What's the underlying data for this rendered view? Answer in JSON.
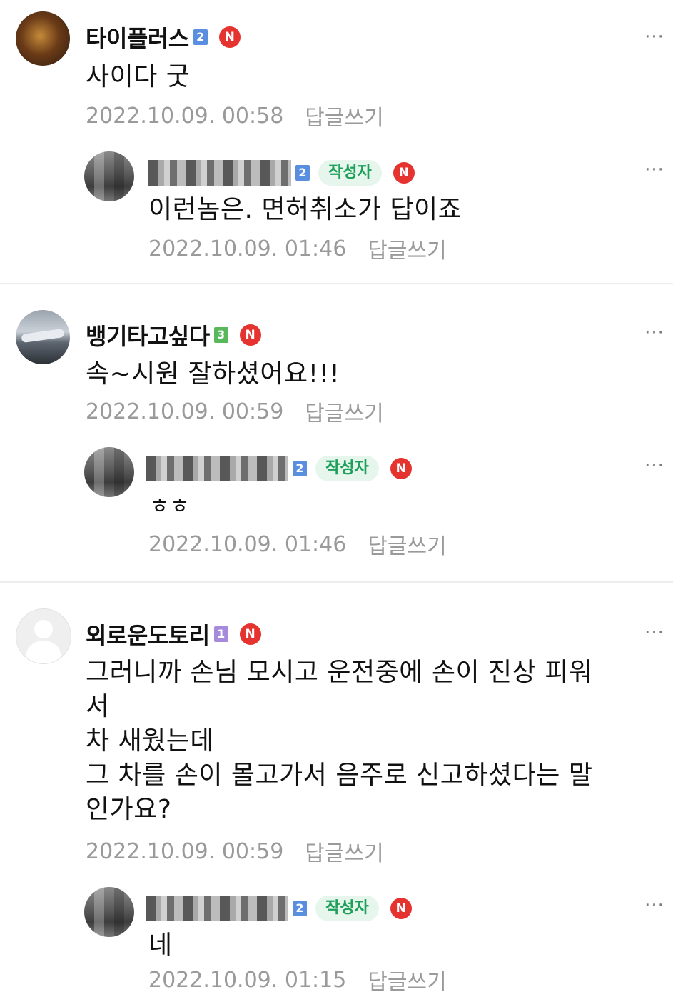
{
  "comments": [
    {
      "nickname": "타이플러스",
      "level": "2",
      "new": "N",
      "text": "사이다 굿",
      "date": "2022.10.09. 00:58",
      "reply_label": "답글쓰기",
      "more": "···",
      "reply": {
        "level": "2",
        "author_badge": "작성자",
        "new": "N",
        "text": "이런놈은. 면허취소가 답이죠",
        "date": "2022.10.09. 01:46",
        "reply_label": "답글쓰기",
        "more": "···"
      }
    },
    {
      "nickname": "뱅기타고싶다",
      "level": "3",
      "new": "N",
      "text": "속~시원 잘하셨어요!!!",
      "date": "2022.10.09. 00:59",
      "reply_label": "답글쓰기",
      "more": "···",
      "reply": {
        "level": "2",
        "author_badge": "작성자",
        "new": "N",
        "text": "ㅎㅎ",
        "date": "2022.10.09. 01:46",
        "reply_label": "답글쓰기",
        "more": "···"
      }
    },
    {
      "nickname": "외로운도토리",
      "level": "1",
      "new": "N",
      "text": "그러니까 손님 모시고 운전중에 손이 진상 피워\n서\n차 새웠는데\n그 차를 손이 몰고가서 음주로 신고하셨다는 말\n인가요?",
      "date": "2022.10.09. 00:59",
      "reply_label": "답글쓰기",
      "more": "···",
      "reply": {
        "level": "2",
        "author_badge": "작성자",
        "new": "N",
        "text": "네",
        "date": "2022.10.09. 01:15",
        "reply_label": "답글쓰기",
        "more": "···"
      }
    }
  ],
  "colors": {
    "level_blue": "#5a8fe0",
    "level_green": "#58b85a",
    "level_purple": "#a68bdc",
    "new_badge": "#e5332f",
    "author_badge_bg": "#e6f6ec",
    "author_badge_text": "#1ea05a",
    "meta_text": "#9a9a9a"
  }
}
